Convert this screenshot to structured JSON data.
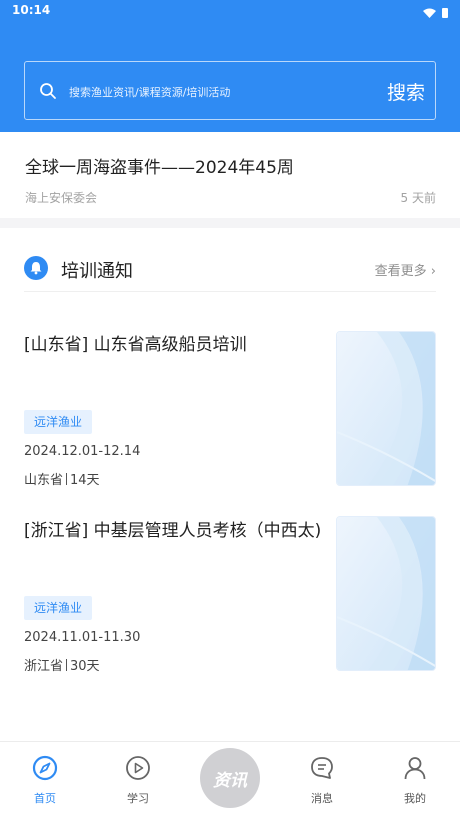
{
  "status": {
    "time": "10:14"
  },
  "search": {
    "placeholder": "搜索渔业资讯/课程资源/培训活动",
    "button": "搜索"
  },
  "news": {
    "title": "全球一周海盗事件——2024年45周",
    "source": "海上安保委会",
    "time": "5 天前"
  },
  "section": {
    "title": "培训通知",
    "more": "查看更多 ›"
  },
  "cards": [
    {
      "title": "[山东省] 山东省高级船员培训",
      "tag": "远洋渔业",
      "date": "2024.12.01-12.14",
      "region": "山东省",
      "days": "14天"
    },
    {
      "title": "[浙江省] 中基层管理人员考核（中西太)",
      "tag": "远洋渔业",
      "date": "2024.11.01-11.30",
      "region": "浙江省",
      "days": "30天"
    }
  ],
  "tabbar": {
    "home": "首页",
    "study": "学习",
    "center": "资讯",
    "messages": "消息",
    "mine": "我的"
  },
  "colors": {
    "primary": "#2f8bf3",
    "center_button": "#d0d0d3"
  }
}
